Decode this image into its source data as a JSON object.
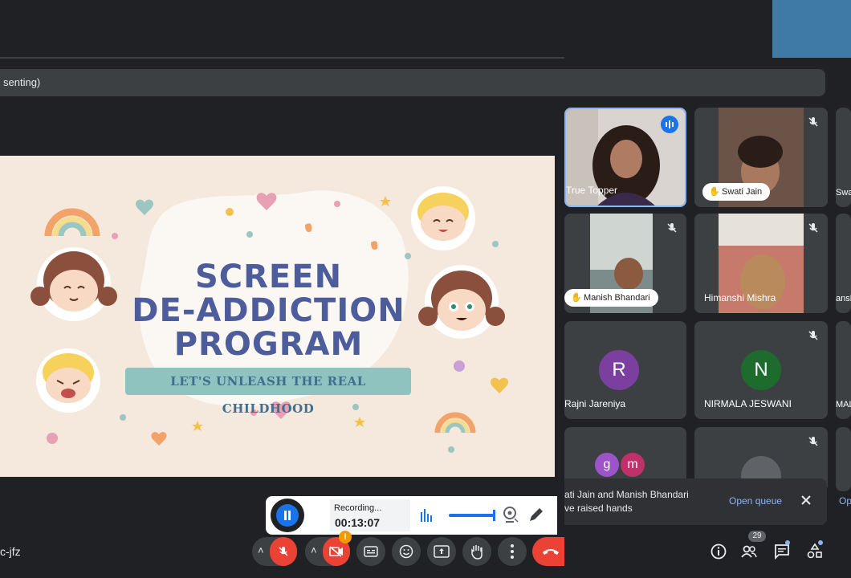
{
  "presenting_label": "senting)",
  "slide": {
    "title_line1": "SCREEN",
    "title_line2": "DE-ADDICTION",
    "title_line3": "PROGRAM",
    "subtitle": "LET'S UNLEASH THE REAL CHILDHOOD"
  },
  "participants": [
    {
      "name": "True Topper",
      "tile": "speaking"
    },
    {
      "name": "Swati Jain",
      "tile": "video",
      "hand_raised": true,
      "muted": true
    },
    {
      "name": "Swati",
      "tile": "partial"
    },
    {
      "name": "Manish Bhandari",
      "tile": "video",
      "hand_raised": true,
      "muted": true
    },
    {
      "name": "Himanshi Mishra",
      "tile": "video",
      "muted": true
    },
    {
      "name": "anshi",
      "tile": "partial"
    },
    {
      "name": "Rajni Jareniya",
      "initial": "R",
      "avatar_color": "#7b3fa0"
    },
    {
      "name": "NIRMALA JESWANI",
      "initial": "N",
      "avatar_color": "#1e6b2e",
      "muted": true
    },
    {
      "name": "MAL",
      "tile": "partial"
    }
  ],
  "raised_hand_avatars": [
    {
      "initial": "g",
      "color": "#9c55c8"
    },
    {
      "initial": "m",
      "color": "#c0306b"
    }
  ],
  "recording": {
    "status": "Recording...",
    "elapsed": "00:13:07"
  },
  "toast": {
    "line1": "ati Jain and Manish Bhandari",
    "line2": "ve raised hands",
    "open_queue": "Open queue",
    "partial_link": "Op"
  },
  "meeting_code": "c-jfz",
  "participant_count": "29",
  "colors": {
    "end_call": "#ea4335",
    "accent_blue": "#1a73e8",
    "tile_bg": "#3c4043",
    "link": "#8ab4f8"
  }
}
